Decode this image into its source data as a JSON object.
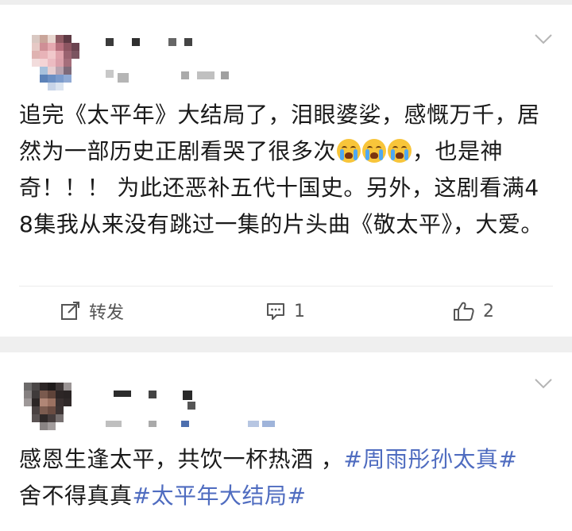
{
  "posts": [
    {
      "text_before_emoji": "追完《太平年》大结局了，泪眼婆娑，感慨万千，居然为一部历史正剧看哭了很多次",
      "emojis": [
        "crying-face",
        "crying-face",
        "crying-face"
      ],
      "text_after_emoji": "，也是神奇！！！ 为此还恶补五代十国史。另外，这剧看满48集我从来没有跳过一集的片头曲《敬太平》，大爱。",
      "actions": {
        "repost_label": "转发",
        "comment_count": "1",
        "like_count": "2"
      }
    },
    {
      "text_plain": "感恩生逢太平，共饮一杯热酒 ，",
      "hashtag_1": "#周雨彤孙太真#",
      "text_plain_2": "舍不得真真",
      "hashtag_2": "#太平年大结局#"
    }
  ],
  "colors": {
    "hashtag": "#4f6cc0",
    "separator": "#efefef",
    "text": "#1a1a1a",
    "action": "#555555"
  }
}
